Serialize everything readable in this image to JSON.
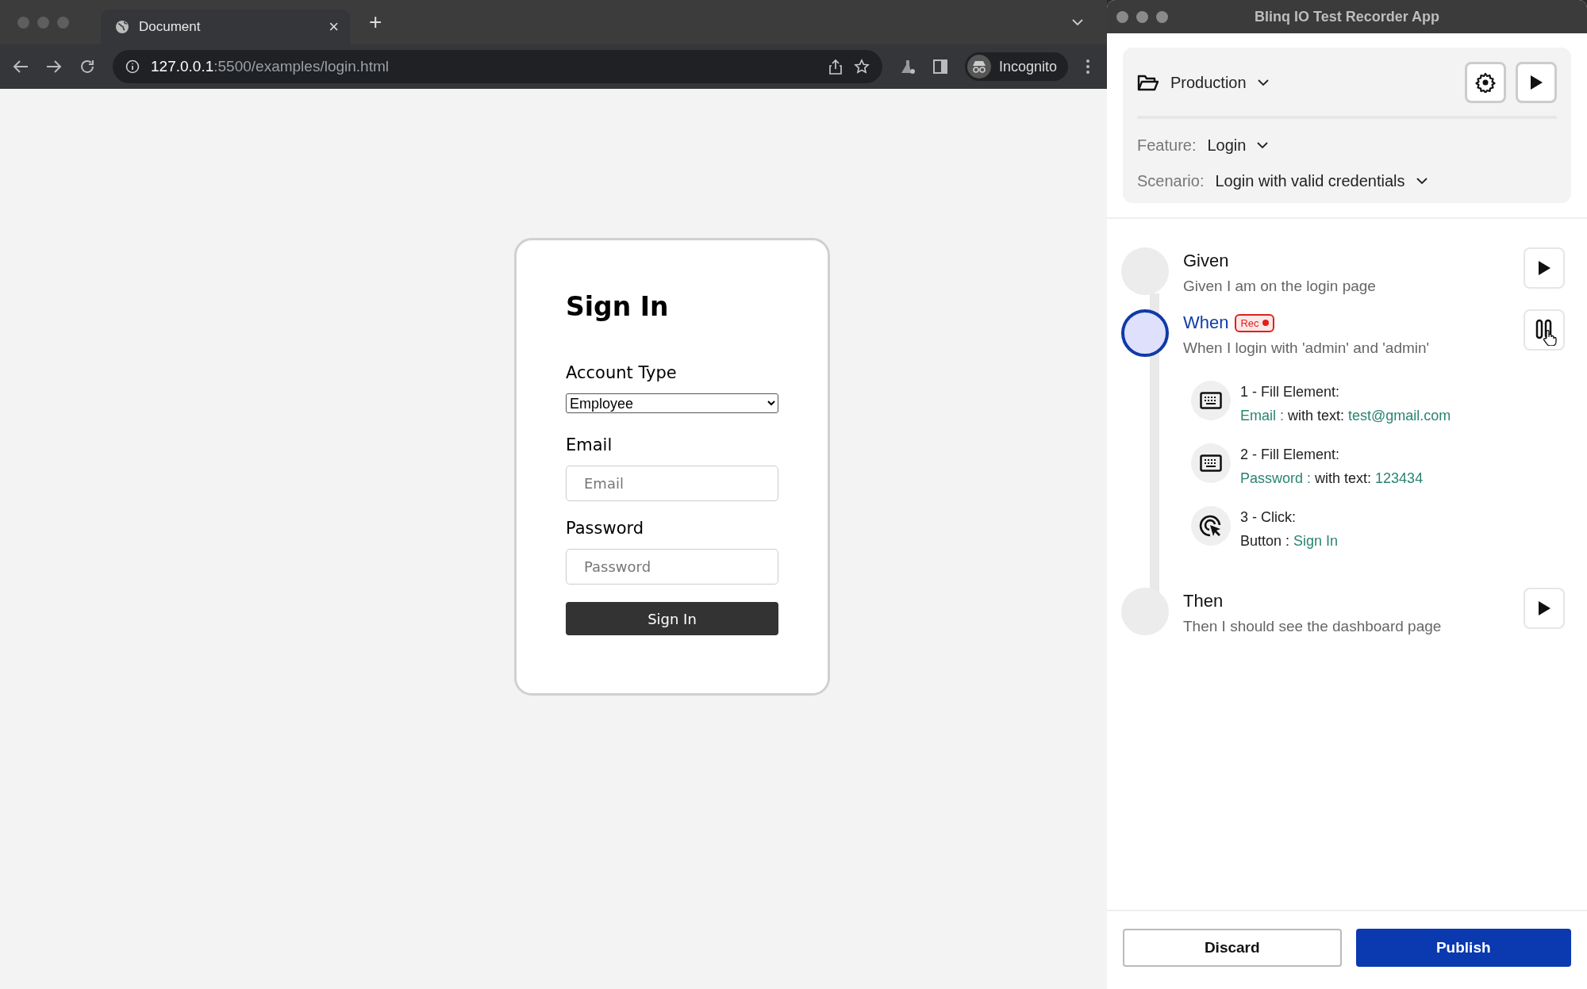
{
  "browser": {
    "tab": {
      "title": "Document",
      "close": "×"
    },
    "new_tab": "+",
    "url": {
      "host": "127.0.0.1",
      "path": ":5500/examples/login.html"
    },
    "profile": "Incognito"
  },
  "login": {
    "title": "Sign In",
    "account_label": "Account Type",
    "account_value": "Employee",
    "email_label": "Email",
    "email_placeholder": "Email",
    "password_label": "Password",
    "password_placeholder": "Password",
    "submit": "Sign In"
  },
  "app": {
    "title": "Blinq IO Test Recorder App",
    "project": "Production",
    "fields": [
      {
        "label": "Feature:",
        "value": "Login"
      },
      {
        "label": "Scenario:",
        "value": "Login with valid credentials"
      }
    ],
    "steps": [
      {
        "keyword": "Given",
        "text": "Given I am on the login page",
        "active": false
      },
      {
        "keyword": "When",
        "badge": "Rec",
        "text": "When I login with 'admin' and 'admin'",
        "active": true,
        "actions": [
          {
            "kind": "fill",
            "title": "1 - Fill Element:",
            "parts": [
              {
                "text": "Email :",
                "highlight": true
              },
              {
                "text": " with text: ",
                "highlight": false
              },
              {
                "text": "test@gmail.com",
                "highlight": true
              }
            ]
          },
          {
            "kind": "fill",
            "title": "2 - Fill Element:",
            "parts": [
              {
                "text": "Password :",
                "highlight": true
              },
              {
                "text": " with text: ",
                "highlight": false
              },
              {
                "text": "123434",
                "highlight": true
              }
            ]
          },
          {
            "kind": "click",
            "title": "3 - Click:",
            "parts": [
              {
                "text": "Button : ",
                "highlight": false
              },
              {
                "text": "Sign In",
                "highlight": true
              }
            ]
          }
        ]
      },
      {
        "keyword": "Then",
        "text": "Then I should see the dashboard page",
        "active": false
      }
    ],
    "buttons": [
      {
        "label": "Discard",
        "kind": "secondary"
      },
      {
        "label": "Publish",
        "kind": "primary"
      }
    ]
  }
}
